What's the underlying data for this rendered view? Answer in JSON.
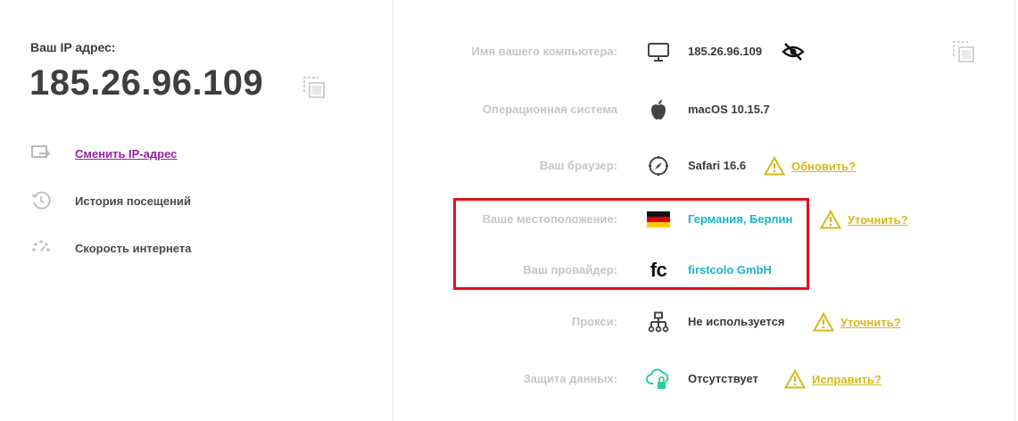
{
  "left": {
    "ip_label": "Ваш IP адрес:",
    "ip_value": "185.26.96.109",
    "menu": [
      {
        "label": "Сменить IP-адрес",
        "icon": "switch-ip-icon",
        "link": true
      },
      {
        "label": "История посещений",
        "icon": "history-icon",
        "link": false
      },
      {
        "label": "Скорость интернета",
        "icon": "speed-icon",
        "link": false
      }
    ]
  },
  "details": {
    "computer": {
      "label": "Имя вашего компьютера:",
      "value": "185.26.96.109"
    },
    "os": {
      "label": "Операционная система",
      "value": "macOS 10.15.7"
    },
    "browser": {
      "label": "Ваш браузер:",
      "value": "Safari 16.6",
      "action": "Обновить?"
    },
    "location": {
      "label": "Ваше местоположение:",
      "value": "Германия, Берлин",
      "action": "Уточнить?"
    },
    "provider": {
      "label": "Ваш провайдер:",
      "value": "firstcolo GmbH",
      "logo_text": "fc"
    },
    "proxy": {
      "label": "Прокси:",
      "value": "Не используется",
      "action": "Уточнить?"
    },
    "protection": {
      "label": "Защита данных:",
      "value": "Отсутствует",
      "action": "Исправить?"
    }
  },
  "colors": {
    "accent": "#1ab3d1",
    "link": "#9b1fa0",
    "warning": "#d8b81c",
    "highlight": "#e0121d",
    "label": "#c6c6c6"
  }
}
